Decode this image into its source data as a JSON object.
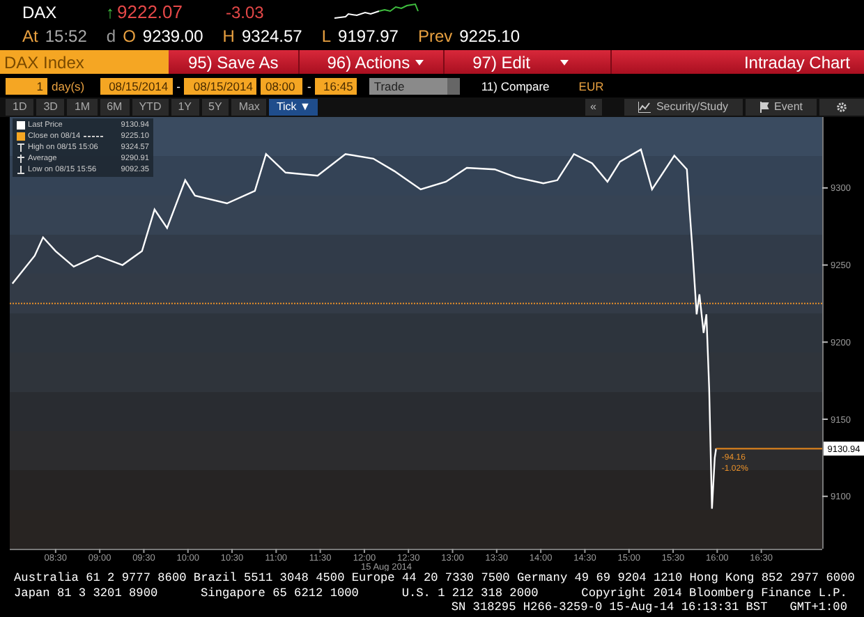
{
  "quote": {
    "ticker": "DAX",
    "change_arrow": "↑",
    "last": "9222.07",
    "change": "-3.03",
    "time_label": "At",
    "time": "15:52",
    "time_flag": "d",
    "open_label": "O",
    "open": "9239.00",
    "high_label": "H",
    "high": "9324.57",
    "low_label": "L",
    "low": "9197.97",
    "prev_label": "Prev",
    "prev": "9225.10"
  },
  "toolbar": {
    "security": "DAX Index",
    "buttons": [
      {
        "label": "95) Save As",
        "dropdown": false
      },
      {
        "label": "96) Actions",
        "dropdown": true
      },
      {
        "label": "97) Edit",
        "dropdown": true
      }
    ],
    "title": "Intraday Chart"
  },
  "range": {
    "count": "1",
    "unit": "day(s)",
    "start_date": "08/15/2014",
    "date_separator": "-",
    "end_date": "08/15/2014",
    "start_time": "08:00",
    "time_separator": "-",
    "end_time": "16:45",
    "field": "Trade",
    "compare": "11) Compare",
    "currency": "EUR"
  },
  "periods": [
    {
      "label": "1D",
      "selected": false
    },
    {
      "label": "3D",
      "selected": false
    },
    {
      "label": "1M",
      "selected": false
    },
    {
      "label": "6M",
      "selected": false
    },
    {
      "label": "YTD",
      "selected": false
    },
    {
      "label": "1Y",
      "selected": false
    },
    {
      "label": "5Y",
      "selected": false
    },
    {
      "label": "Max",
      "selected": false
    },
    {
      "label": "Tick ▼",
      "selected": true
    }
  ],
  "tools": [
    {
      "kind": "collapse",
      "label": "«"
    },
    {
      "kind": "study",
      "label": "Security/Study"
    },
    {
      "kind": "event",
      "label": "Event"
    },
    {
      "kind": "settings"
    }
  ],
  "legend": [
    {
      "kind": "last",
      "label": "Last Price",
      "value": "9130.94"
    },
    {
      "kind": "close",
      "label": "Close on 08/14",
      "value": "9225.10"
    },
    {
      "kind": "high",
      "label": "High on 08/15 15:06",
      "value": "9324.57"
    },
    {
      "kind": "average",
      "label": "Average",
      "value": "9290.91"
    },
    {
      "kind": "low",
      "label": "Low on 08/15 15:56",
      "value": "9092.35"
    }
  ],
  "chart_data": {
    "type": "line",
    "xlabel": "15 Aug 2014",
    "xlim": [
      7.98,
      17.19
    ],
    "ylim": [
      9066,
      9346
    ],
    "xticks": [
      {
        "value": 8.5,
        "label": "08:30"
      },
      {
        "value": 9,
        "label": "09:00"
      },
      {
        "value": 9.5,
        "label": "09:30"
      },
      {
        "value": 10,
        "label": "10:00"
      },
      {
        "value": 10.5,
        "label": "10:30"
      },
      {
        "value": 11,
        "label": "11:00"
      },
      {
        "value": 11.5,
        "label": "11:30"
      },
      {
        "value": 12,
        "label": "12:00"
      },
      {
        "value": 12.5,
        "label": "12:30"
      },
      {
        "value": 13,
        "label": "13:00"
      },
      {
        "value": 13.5,
        "label": "13:30"
      },
      {
        "value": 14,
        "label": "14:00"
      },
      {
        "value": 14.5,
        "label": "14:30"
      },
      {
        "value": 15,
        "label": "15:00"
      },
      {
        "value": 15.5,
        "label": "15:30"
      },
      {
        "value": 16,
        "label": "16:00"
      },
      {
        "value": 16.5,
        "label": "16:30"
      }
    ],
    "yticks": [
      9100,
      9150,
      9200,
      9250,
      9300
    ],
    "x": [
      8.01,
      8.263,
      8.358,
      8.5,
      8.705,
      8.974,
      9.258,
      9.479,
      9.622,
      9.764,
      9.969,
      10.08,
      10.443,
      10.759,
      10.885,
      11.107,
      11.47,
      11.786,
      12.102,
      12.339,
      12.639,
      12.924,
      13.161,
      13.477,
      13.714,
      14.029,
      14.187,
      14.377,
      14.582,
      14.756,
      14.898,
      15.135,
      15.261,
      15.514,
      15.656,
      15.688,
      15.72,
      15.767,
      15.799,
      15.846,
      15.878,
      15.909,
      15.941,
      15.972,
      15.988
    ],
    "series": [
      {
        "color": "#ffffff",
        "values": [
          9238,
          9256,
          9268,
          9259,
          9249,
          9256,
          9250,
          9259,
          9286,
          9274,
          9305,
          9295,
          9290,
          9298,
          9322,
          9310,
          9308,
          9322,
          9319,
          9311,
          9299,
          9304,
          9313,
          9312,
          9307,
          9303,
          9305,
          9322,
          9316,
          9304,
          9317,
          9325,
          9299,
          9321,
          9312,
          9285,
          9260,
          9218,
          9231,
          9206,
          9218,
          9170,
          9092,
          9125,
          9131
        ]
      }
    ],
    "ref_lines": [
      {
        "axis": "y",
        "value": 9225.1
      },
      {
        "axis": "y",
        "value": 9130.94,
        "label": "9130.94"
      }
    ],
    "annotations": [
      "-94.16",
      "-1.02%"
    ]
  },
  "footer": [
    [
      "Australia 61 2 9777 8600 Brazil 5511 3048 4500 Europe 44 20 7330 7500 Germany 49 69 9204 1210 Hong Kong 852 2977 6000"
    ],
    [
      "Japan 81 3 3201 8900",
      "Singapore 65 6212 1000",
      "U.S. 1 212 318 2000",
      "Copyright 2014 Bloomberg Finance L.P."
    ],
    [
      "SN 318295 H266-3259-0 15-Aug-14 16:13:31 BST",
      "GMT+1:00"
    ]
  ]
}
